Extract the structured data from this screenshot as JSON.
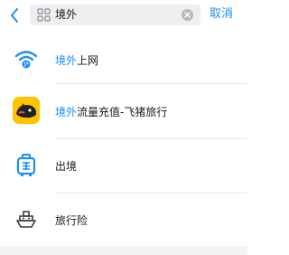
{
  "header": {
    "back_icon": "chevron-left-icon",
    "search": {
      "icon": "grid-search-icon",
      "value": "境外",
      "placeholder": ""
    },
    "clear_icon": "clear-circle-icon",
    "cancel_label": "取消"
  },
  "results": [
    {
      "icon": "wifi-globe-icon",
      "highlight": "境外",
      "rest": "上网"
    },
    {
      "icon": "fliggy-pig-icon",
      "highlight": "境外",
      "rest": "流量充值-飞猪旅行"
    },
    {
      "icon": "luggage-icon",
      "highlight": "",
      "rest": "出境"
    },
    {
      "icon": "ship-icon",
      "highlight": "",
      "rest": "旅行险"
    }
  ],
  "colors": {
    "accent": "#1b8ff2",
    "search_bg": "#eeeff1",
    "fliggy_yellow": "#ffc300",
    "text": "#1a1a1a",
    "divider": "#e6e6e6"
  }
}
